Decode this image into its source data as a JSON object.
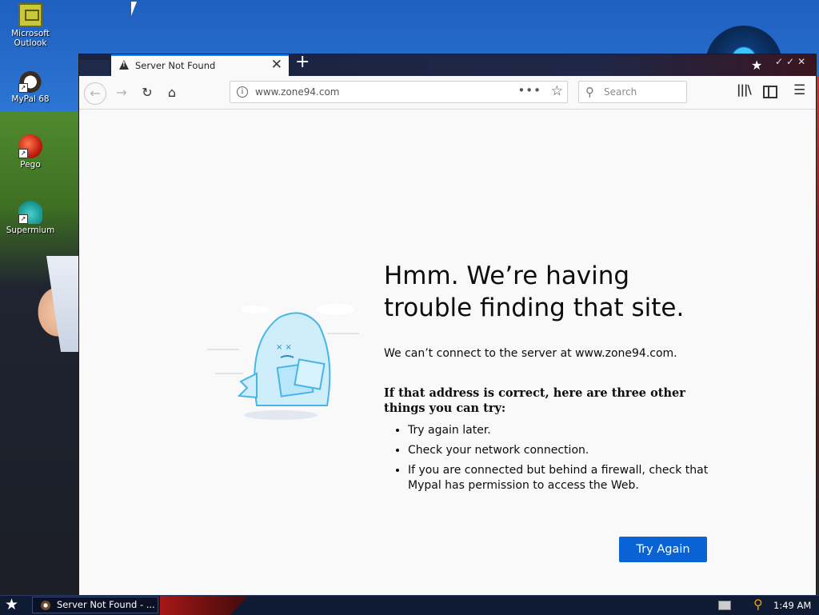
{
  "desktop": {
    "icons": [
      {
        "label": "Microsoft\nOutlook",
        "icon": "outlook-icon"
      },
      {
        "label": "MyPal 68",
        "icon": "mypal-icon"
      },
      {
        "label": "Pego",
        "icon": "pego-icon"
      },
      {
        "label": "Supermium",
        "icon": "supermium-icon"
      }
    ],
    "icon_labels": {
      "outlook_line1": "Microsoft",
      "outlook_line2": "Outlook",
      "mypal": "MyPal 68",
      "pego": "Pego",
      "supermium": "Supermium"
    }
  },
  "browser": {
    "tab": {
      "title": "Server Not Found",
      "close": "✕"
    },
    "new_tab": "+",
    "address": {
      "url": "www.zone94.com",
      "page_actions": "•••"
    },
    "search": {
      "placeholder": "Search"
    }
  },
  "error_page": {
    "title": "Hmm. We’re having trouble finding that site.",
    "description": "We can’t connect to the server at www.zone94.com.",
    "subtitle": "If that address is correct, here are three other things you can try:",
    "suggestions": [
      "Try again later.",
      "Check your network connection.",
      "If you are connected but behind a firewall, check that Mypal has permission to access the Web."
    ],
    "button": "Try Again"
  },
  "taskbar": {
    "task_label": "Server Not Found - ...",
    "clock": "1:49 AM"
  },
  "colors": {
    "accent": "#0a84ff",
    "button": "#0a63d4",
    "taskbar": "#0f1a33",
    "page_bg": "#f9f9fa"
  }
}
